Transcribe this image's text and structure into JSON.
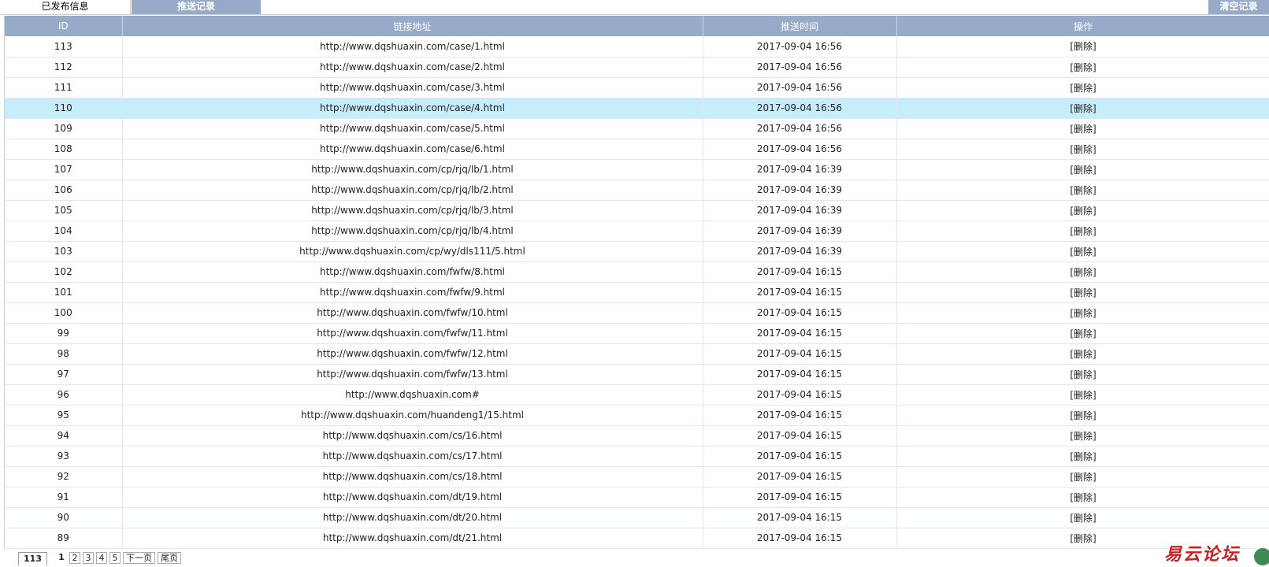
{
  "tabs": {
    "published": "已发布信息",
    "push_log": "推送记录",
    "clear": "清空记录"
  },
  "table": {
    "headers": [
      "ID",
      "链接地址",
      "推送时间",
      "操作"
    ],
    "rows": [
      {
        "id": "113",
        "url": "http://www.dqshuaxin.com/case/1.html",
        "time": "2017-09-04 16:56",
        "op": "[删除]"
      },
      {
        "id": "112",
        "url": "http://www.dqshuaxin.com/case/2.html",
        "time": "2017-09-04 16:56",
        "op": "[删除]"
      },
      {
        "id": "111",
        "url": "http://www.dqshuaxin.com/case/3.html",
        "time": "2017-09-04 16:56",
        "op": "[删除]"
      },
      {
        "id": "110",
        "url": "http://www.dqshuaxin.com/case/4.html",
        "time": "2017-09-04 16:56",
        "op": "[删除]"
      },
      {
        "id": "109",
        "url": "http://www.dqshuaxin.com/case/5.html",
        "time": "2017-09-04 16:56",
        "op": "[删除]"
      },
      {
        "id": "108",
        "url": "http://www.dqshuaxin.com/case/6.html",
        "time": "2017-09-04 16:56",
        "op": "[删除]"
      },
      {
        "id": "107",
        "url": "http://www.dqshuaxin.com/cp/rjq/lb/1.html",
        "time": "2017-09-04 16:39",
        "op": "[删除]"
      },
      {
        "id": "106",
        "url": "http://www.dqshuaxin.com/cp/rjq/lb/2.html",
        "time": "2017-09-04 16:39",
        "op": "[删除]"
      },
      {
        "id": "105",
        "url": "http://www.dqshuaxin.com/cp/rjq/lb/3.html",
        "time": "2017-09-04 16:39",
        "op": "[删除]"
      },
      {
        "id": "104",
        "url": "http://www.dqshuaxin.com/cp/rjq/lb/4.html",
        "time": "2017-09-04 16:39",
        "op": "[删除]"
      },
      {
        "id": "103",
        "url": "http://www.dqshuaxin.com/cp/wy/dls111/5.html",
        "time": "2017-09-04 16:39",
        "op": "[删除]"
      },
      {
        "id": "102",
        "url": "http://www.dqshuaxin.com/fwfw/8.html",
        "time": "2017-09-04 16:15",
        "op": "[删除]"
      },
      {
        "id": "101",
        "url": "http://www.dqshuaxin.com/fwfw/9.html",
        "time": "2017-09-04 16:15",
        "op": "[删除]"
      },
      {
        "id": "100",
        "url": "http://www.dqshuaxin.com/fwfw/10.html",
        "time": "2017-09-04 16:15",
        "op": "[删除]"
      },
      {
        "id": "99",
        "url": "http://www.dqshuaxin.com/fwfw/11.html",
        "time": "2017-09-04 16:15",
        "op": "[删除]"
      },
      {
        "id": "98",
        "url": "http://www.dqshuaxin.com/fwfw/12.html",
        "time": "2017-09-04 16:15",
        "op": "[删除]"
      },
      {
        "id": "97",
        "url": "http://www.dqshuaxin.com/fwfw/13.html",
        "time": "2017-09-04 16:15",
        "op": "[删除]"
      },
      {
        "id": "96",
        "url": "http://www.dqshuaxin.com#",
        "time": "2017-09-04 16:15",
        "op": "[删除]"
      },
      {
        "id": "95",
        "url": "http://www.dqshuaxin.com/huandeng1/15.html",
        "time": "2017-09-04 16:15",
        "op": "[删除]"
      },
      {
        "id": "94",
        "url": "http://www.dqshuaxin.com/cs/16.html",
        "time": "2017-09-04 16:15",
        "op": "[删除]"
      },
      {
        "id": "93",
        "url": "http://www.dqshuaxin.com/cs/17.html",
        "time": "2017-09-04 16:15",
        "op": "[删除]"
      },
      {
        "id": "92",
        "url": "http://www.dqshuaxin.com/cs/18.html",
        "time": "2017-09-04 16:15",
        "op": "[删除]"
      },
      {
        "id": "91",
        "url": "http://www.dqshuaxin.com/dt/19.html",
        "time": "2017-09-04 16:15",
        "op": "[删除]"
      },
      {
        "id": "90",
        "url": "http://www.dqshuaxin.com/dt/20.html",
        "time": "2017-09-04 16:15",
        "op": "[删除]"
      },
      {
        "id": "89",
        "url": "http://www.dqshuaxin.com/dt/21.html",
        "time": "2017-09-04 16:15",
        "op": "[删除]"
      }
    ],
    "selected_id": "110"
  },
  "pager": {
    "total": "113",
    "pages": [
      "1",
      "2",
      "3",
      "4",
      "5"
    ],
    "current": "1",
    "next": "下一页",
    "last": "尾页"
  },
  "watermark": {
    "text": "易云论坛",
    "color": "#cc1f1f"
  },
  "colors": {
    "header_bg": "#97aac8",
    "selected_row": "#c6edfb"
  }
}
